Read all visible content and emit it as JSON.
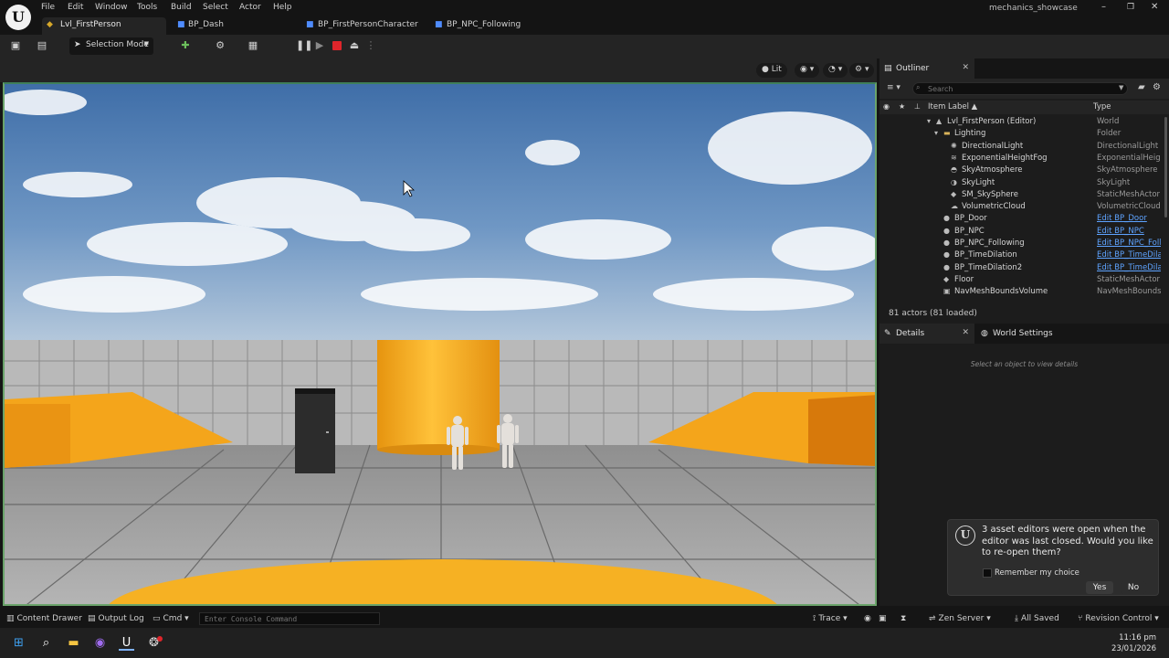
{
  "menu": [
    "File",
    "Edit",
    "Window",
    "Tools",
    "Build",
    "Select",
    "Actor",
    "Help"
  ],
  "tabs": [
    {
      "label": "Lvl_FirstPerson",
      "icon": "level-icon"
    },
    {
      "label": "BP_Dash",
      "icon": "blueprint-icon"
    },
    {
      "label": "BP_FirstPersonCharacter",
      "icon": "blueprint-icon"
    },
    {
      "label": "BP_NPC_Following",
      "icon": "blueprint-icon"
    }
  ],
  "project_name": "mechanics_showcase",
  "toolbar": {
    "mode_label": "Selection Mode"
  },
  "viewport": {
    "view_mode": "Lit"
  },
  "outliner": {
    "title": "Outliner",
    "search_placeholder": "Search",
    "col_label": "Item Label ▲",
    "col_type": "Type",
    "rows": [
      {
        "label": "Lvl_FirstPerson (Editor)",
        "type": "World",
        "indent": 0,
        "icon": "world-icon"
      },
      {
        "label": "Lighting",
        "type": "Folder",
        "indent": 1,
        "icon": "folder-icon"
      },
      {
        "label": "DirectionalLight",
        "type": "DirectionalLight",
        "indent": 2,
        "icon": "light-icon"
      },
      {
        "label": "ExponentialHeightFog",
        "type": "ExponentialHeight",
        "indent": 2,
        "icon": "fog-icon"
      },
      {
        "label": "SkyAtmosphere",
        "type": "SkyAtmosphere",
        "indent": 2,
        "icon": "sky-icon"
      },
      {
        "label": "SkyLight",
        "type": "SkyLight",
        "indent": 2,
        "icon": "skylight-icon"
      },
      {
        "label": "SM_SkySphere",
        "type": "StaticMeshActor",
        "indent": 2,
        "icon": "mesh-icon"
      },
      {
        "label": "VolumetricCloud",
        "type": "VolumetricCloud",
        "indent": 2,
        "icon": "cloud-icon"
      },
      {
        "label": "BP_Door",
        "type": "Edit BP_Door",
        "indent": 1,
        "icon": "actor-icon",
        "link": true
      },
      {
        "label": "BP_NPC",
        "type": "Edit BP_NPC",
        "indent": 1,
        "icon": "actor-icon",
        "link": true
      },
      {
        "label": "BP_NPC_Following",
        "type": "Edit BP_NPC_Follo",
        "indent": 1,
        "icon": "actor-icon",
        "link": true
      },
      {
        "label": "BP_TimeDilation",
        "type": "Edit BP_TimeDilat",
        "indent": 1,
        "icon": "actor-icon",
        "link": true
      },
      {
        "label": "BP_TimeDilation2",
        "type": "Edit BP_TimeDilat",
        "indent": 1,
        "icon": "actor-icon",
        "link": true
      },
      {
        "label": "Floor",
        "type": "StaticMeshActor",
        "indent": 1,
        "icon": "mesh-icon"
      },
      {
        "label": "NavMeshBoundsVolume",
        "type": "NavMeshBounds\\",
        "indent": 1,
        "icon": "volume-icon"
      }
    ],
    "actor_count": "81 actors (81 loaded)"
  },
  "details": {
    "tab_label": "Details",
    "world_settings_label": "World Settings",
    "empty_text": "Select an object to view details"
  },
  "notification": {
    "message": "3 asset editors were open when the editor was last closed. Would you like to re-open them?",
    "checkbox_label": "Remember my choice",
    "yes_label": "Yes",
    "no_label": "No"
  },
  "statusbar": {
    "content_drawer": "Content Drawer",
    "output_log": "Output Log",
    "cmd": "Cmd",
    "console_placeholder": "Enter Console Command",
    "trace": "Trace",
    "zen_server": "Zen Server",
    "all_saved": "All Saved",
    "revision_control": "Revision Control"
  },
  "taskbar": {
    "time": "11:16 pm",
    "date": "23/01/2026"
  },
  "colors": {
    "accent_orange": "#f6a51c",
    "link_blue": "#5ea3ff",
    "viewport_border": "#6aa36a"
  }
}
